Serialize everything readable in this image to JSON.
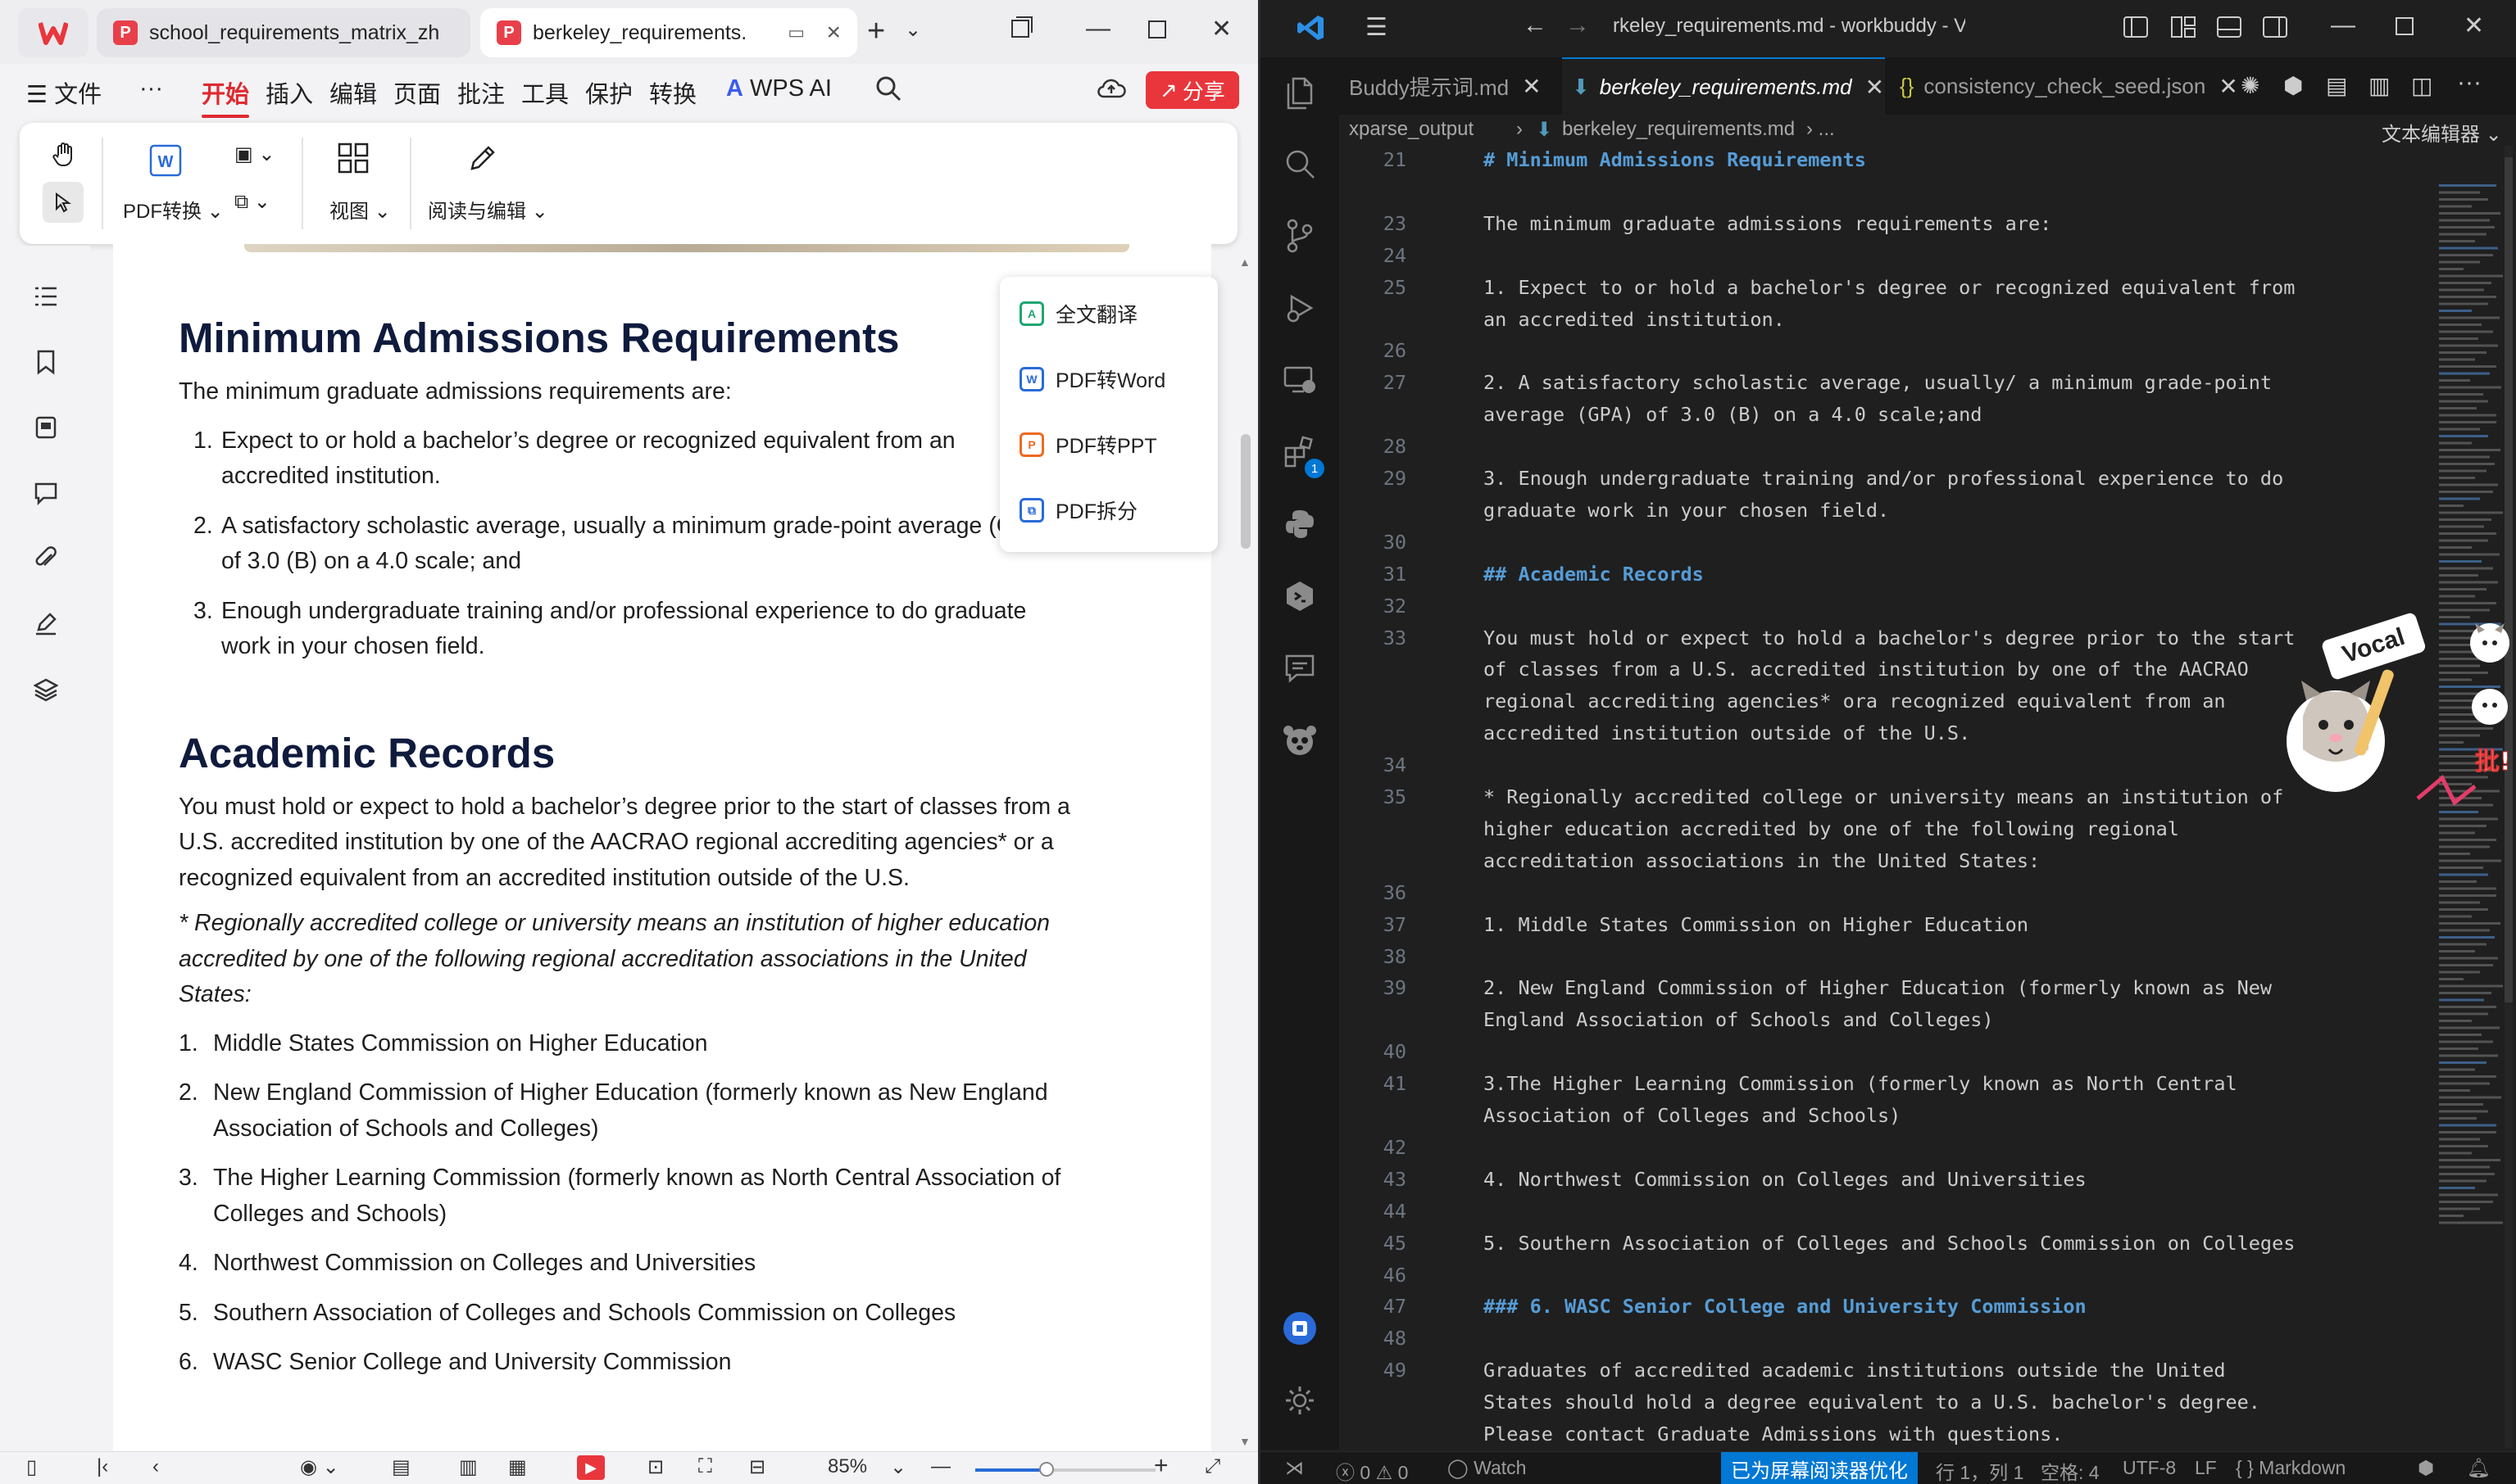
{
  "wps": {
    "tabs": [
      {
        "label": "school_requirements_matrix_zh"
      },
      {
        "label": "berkeley_requirements."
      }
    ],
    "menu": [
      "文件",
      "开始",
      "插入",
      "编辑",
      "页面",
      "批注",
      "工具",
      "保护",
      "转换",
      "WPS AI"
    ],
    "more_label": "···",
    "share_label": "分享",
    "ribbon": {
      "pdf_convert": "PDF转换",
      "view": "视图",
      "read_edit": "阅读与编辑"
    },
    "popup": [
      "全文翻译",
      "PDF转Word",
      "PDF转PPT",
      "PDF拆分"
    ],
    "doc": {
      "h1": "Minimum Admissions Requirements",
      "intro": "The minimum graduate admissions requirements are:",
      "req": [
        {
          "num": "1.",
          "a": "Expect to or hold a bachelor’s degree or recognized equivalent from an",
          "b": "accredited institution."
        },
        {
          "num": "2.",
          "a": "A satisfactory scholastic average, usually a minimum grade-point average (GPA)",
          "b": "of 3.0 (B) on a 4.0 scale; and"
        },
        {
          "num": "3.",
          "a": "Enough undergraduate training and/or professional experience to do graduate",
          "b": "work in your chosen field."
        }
      ],
      "h2": "Academic Records",
      "para": [
        "You must hold or expect to hold a bachelor’s degree prior to the start of classes from a",
        "U.S. accredited institution by one of the AACRAO regional accrediting agencies* or a",
        "recognized equivalent from an accredited institution outside of the U.S."
      ],
      "note": [
        "* Regionally accredited college or university means an institution of higher education",
        "accredited by one of the following regional accreditation associations in the United",
        "States:"
      ],
      "agencies": [
        {
          "num": "1.",
          "a": "Middle States Commission on Higher Education",
          "b": ""
        },
        {
          "num": "2.",
          "a": "New England Commission of Higher Education (formerly known as New England",
          "b": "Association of Schools and Colleges)"
        },
        {
          "num": "3.",
          "a": "The Higher Learning Commission (formerly known as North Central Association of",
          "b": "Colleges and Schools)"
        },
        {
          "num": "4.",
          "a": "Northwest Commission on Colleges and Universities",
          "b": ""
        },
        {
          "num": "5.",
          "a": "Southern Association of Colleges and Schools Commission on Colleges",
          "b": ""
        },
        {
          "num": "6.",
          "a": "WASC Senior College and University Commission",
          "b": ""
        }
      ]
    },
    "zoom": "85%"
  },
  "vscode": {
    "title": "rkeley_requirements.md - workbuddy - Visual Studio Co",
    "tabs": [
      {
        "label": "Buddy提示词.md"
      },
      {
        "label": "berkeley_requirements.md"
      },
      {
        "label": "consistency_check_seed.json"
      }
    ],
    "breadcrumb": {
      "folder": "xparse_output",
      "sep": "›",
      "file": "berkeley_requirements.md",
      "tail": "› ..."
    },
    "text_editor_label": "文本编辑器",
    "lines": [
      {
        "n": "21",
        "t": "# Minimum Admissions Requirements",
        "h": true
      },
      {
        "n": "",
        "t": "",
        "h": false
      },
      {
        "n": "23",
        "t": "The minimum graduate admissions requirements are:",
        "h": false
      },
      {
        "n": "24",
        "t": "",
        "h": false
      },
      {
        "n": "25",
        "t": "1. Expect to or hold a bachelor's degree or recognized equivalent from",
        "h": false
      },
      {
        "n": "",
        "t": "an accredited institution.",
        "h": false
      },
      {
        "n": "26",
        "t": "",
        "h": false
      },
      {
        "n": "27",
        "t": "2. A satisfactory scholastic average, usually/ a minimum grade-point",
        "h": false
      },
      {
        "n": "",
        "t": "average (GPA) of 3.0 (B) on a 4.0 scale;and",
        "h": false
      },
      {
        "n": "28",
        "t": "",
        "h": false
      },
      {
        "n": "29",
        "t": "3. Enough undergraduate training and/or professional experience to do",
        "h": false
      },
      {
        "n": "",
        "t": "graduate work in your chosen field.",
        "h": false
      },
      {
        "n": "30",
        "t": "",
        "h": false
      },
      {
        "n": "31",
        "t": "## Academic Records",
        "h": true
      },
      {
        "n": "32",
        "t": "",
        "h": false
      },
      {
        "n": "33",
        "t": "You must hold or expect to hold a bachelor's degree prior to the start",
        "h": false
      },
      {
        "n": "",
        "t": "of classes from a U.S. accredited institution by one of the AACRAO",
        "h": false
      },
      {
        "n": "",
        "t": "regional accrediting agencies* ora recognized equivalent from an",
        "h": false
      },
      {
        "n": "",
        "t": "accredited institution outside of the U.S.",
        "h": false
      },
      {
        "n": "34",
        "t": "",
        "h": false
      },
      {
        "n": "35",
        "t": "* Regionally accredited college or university means an institution of",
        "h": false
      },
      {
        "n": "",
        "t": "higher education accredited by one of the following regional",
        "h": false
      },
      {
        "n": "",
        "t": "accreditation associations in the United States:",
        "h": false
      },
      {
        "n": "36",
        "t": "",
        "h": false
      },
      {
        "n": "37",
        "t": "1. Middle States Commission on Higher Education",
        "h": false
      },
      {
        "n": "38",
        "t": "",
        "h": false
      },
      {
        "n": "39",
        "t": "2. New England Commission of Higher Education (formerly known as New",
        "h": false
      },
      {
        "n": "",
        "t": "England Association of Schools and Colleges)",
        "h": false
      },
      {
        "n": "40",
        "t": "",
        "h": false
      },
      {
        "n": "41",
        "t": "3.The Higher Learning Commission (formerly known as North Central",
        "h": false
      },
      {
        "n": "",
        "t": "Association of Colleges and Schools)",
        "h": false
      },
      {
        "n": "42",
        "t": "",
        "h": false
      },
      {
        "n": "43",
        "t": "4. Northwest Commission on Colleges and Universities",
        "h": false
      },
      {
        "n": "44",
        "t": "",
        "h": false
      },
      {
        "n": "45",
        "t": "5. Southern Association of Colleges and Schools Commission on Colleges",
        "h": false
      },
      {
        "n": "46",
        "t": "",
        "h": false
      },
      {
        "n": "47",
        "t": "### 6. WASC Senior College and University Commission",
        "h": true
      },
      {
        "n": "48",
        "t": "",
        "h": false
      },
      {
        "n": "49",
        "t": "Graduates of accredited academic institutions outside the United",
        "h": false
      },
      {
        "n": "",
        "t": "States should hold a degree equivalent to a U.S. bachelor's degree.",
        "h": false
      },
      {
        "n": "",
        "t": "Please contact Graduate Admissions with questions.",
        "h": false
      },
      {
        "n": "50",
        "t": "",
        "h": false
      }
    ],
    "status": {
      "errors": "0",
      "warnings": "0",
      "watch": "Watch",
      "screen_reader": "已为屏幕阅读器优化",
      "position": "行 1，列 1",
      "spaces": "空格: 4",
      "encoding": "UTF-8",
      "eol": "LF",
      "language": "Markdown"
    }
  },
  "sticker_text": {
    "vocal": "Vocal",
    "pi": "批!"
  }
}
